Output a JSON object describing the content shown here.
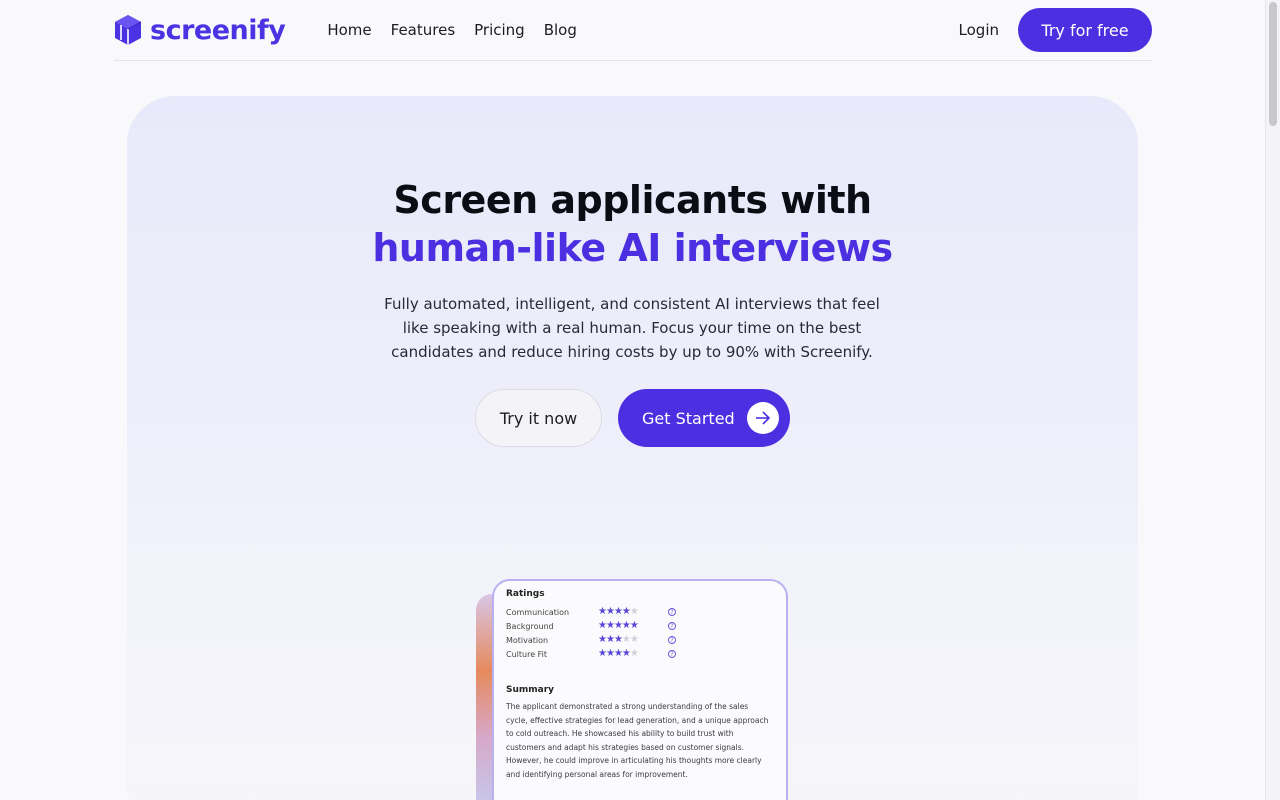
{
  "brand": {
    "name": "screenify",
    "color": "#4b33e3"
  },
  "nav": {
    "items": [
      "Home",
      "Features",
      "Pricing",
      "Blog"
    ]
  },
  "header": {
    "login_label": "Login",
    "cta_label": "Try for free"
  },
  "hero": {
    "title_line1": "Screen applicants with",
    "title_line2": "human-like AI interviews",
    "description": "Fully automated, intelligent, and consistent AI interviews that feel like speaking with a real human. Focus your time on the best candidates and reduce hiring costs by up to 90% with Screenify.",
    "secondary_button": "Try it now",
    "primary_button": "Get Started"
  },
  "card": {
    "ratings_title": "Ratings",
    "ratings": [
      {
        "label": "Communication",
        "stars": 4,
        "max": 5
      },
      {
        "label": "Background",
        "stars": 5,
        "max": 5
      },
      {
        "label": "Motivation",
        "stars": 3,
        "max": 5
      },
      {
        "label": "Culture Fit",
        "stars": 4,
        "max": 5
      }
    ],
    "help_glyph": "?",
    "summary_title": "Summary",
    "summary_text": "The applicant demonstrated a strong understanding of the sales cycle, effective strategies for lead generation, and a unique approach to cold outreach. He showcased his ability to build trust with customers and adapt his strategies based on customer signals. However, he could improve in articulating his thoughts more clearly and identifying personal areas for improvement."
  },
  "colors": {
    "accent": "#4b2fe0",
    "star": "#5a48d8",
    "star_off": "#cfcfdc"
  }
}
